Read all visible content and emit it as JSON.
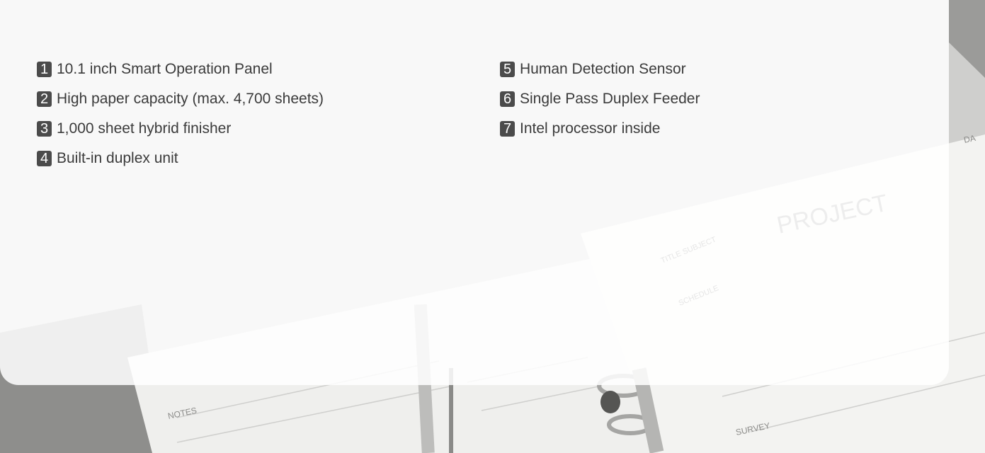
{
  "features_left": [
    {
      "number": "1",
      "label": "10.1 inch Smart Operation Panel"
    },
    {
      "number": "2",
      "label": "High paper capacity (max. 4,700 sheets)"
    },
    {
      "number": "3",
      "label": "1,000 sheet hybrid finisher"
    },
    {
      "number": "4",
      "label": "Built-in duplex unit"
    }
  ],
  "features_right": [
    {
      "number": "5",
      "label": "Human Detection Sensor"
    },
    {
      "number": "6",
      "label": "Single Pass Duplex Feeder"
    },
    {
      "number": "7",
      "label": "Intel processor inside"
    }
  ],
  "background": {
    "notes_label": "NOTES",
    "survey_label": "SURVEY",
    "project_label": "PROJECT",
    "title_subject_label": "TITLE SUBJECT",
    "schedule_label": "SCHEDULE",
    "date_label": "DA"
  },
  "colors": {
    "badge": "#4b4b4b",
    "text": "#3b3b3b",
    "panel": "#ffffff"
  }
}
